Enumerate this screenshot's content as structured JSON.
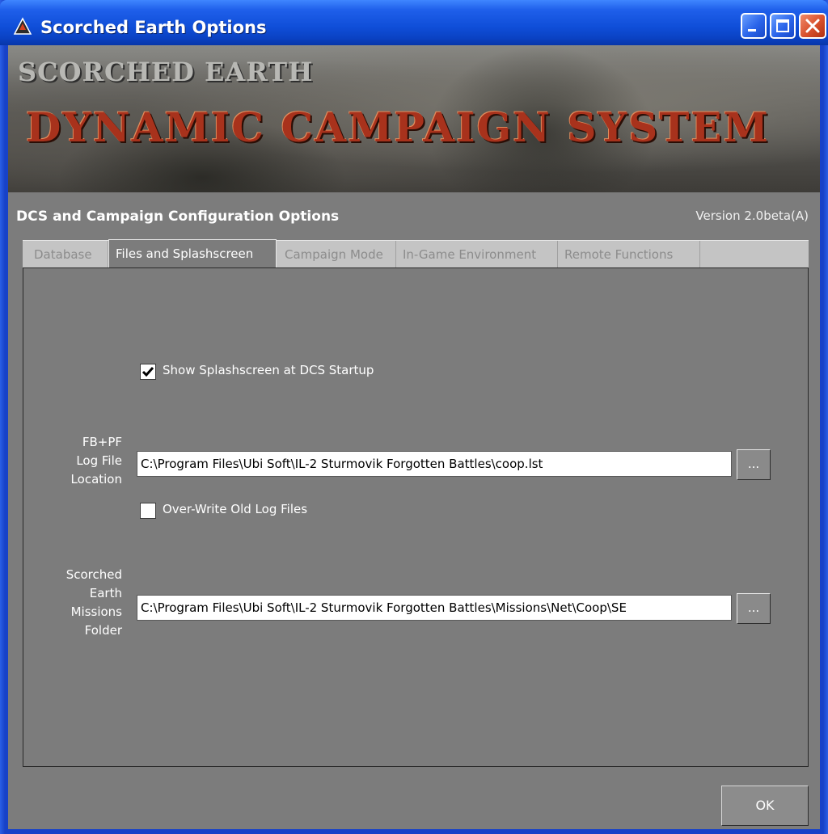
{
  "window": {
    "title": "Scorched Earth Options",
    "icon": "scorched-earth-app-icon",
    "controls": [
      "minimize-icon",
      "maximize-icon",
      "close-icon"
    ]
  },
  "banner": {
    "subtitle": "SCORCHED EARTH",
    "title": "DYNAMIC CAMPAIGN SYSTEM"
  },
  "header": {
    "section_title": "DCS and Campaign Configuration Options",
    "version": "Version 2.0beta(A)"
  },
  "tabs": [
    {
      "label": "Database",
      "active": false
    },
    {
      "label": "Files and Splashscreen",
      "active": true
    },
    {
      "label": "Campaign Mode",
      "active": false
    },
    {
      "label": "In-Game Environment",
      "active": false
    },
    {
      "label": "Remote Functions",
      "active": false
    }
  ],
  "form": {
    "splash_checkbox": {
      "label": "Show Splashscreen at DCS Startup",
      "checked": true
    },
    "log_file": {
      "label_lines": [
        "FB+PF",
        "Log File",
        "Location"
      ],
      "value": "C:\\Program Files\\Ubi Soft\\IL-2 Sturmovik Forgotten Battles\\coop.lst",
      "browse_label": "..."
    },
    "overwrite_checkbox": {
      "label": "Over-Write Old Log Files",
      "checked": false
    },
    "missions_folder": {
      "label_lines": [
        "Scorched",
        "Earth",
        "Missions",
        "Folder"
      ],
      "value": "C:\\Program Files\\Ubi Soft\\IL-2 Sturmovik Forgotten Battles\\Missions\\Net\\Coop\\SE",
      "browse_label": "..."
    }
  },
  "footer": {
    "ok_label": "OK"
  },
  "colors": {
    "titlebar": "#0f4ed8",
    "client_bg": "#7c7c7c",
    "banner_title": "#a8321c",
    "tab_strip": "#c4c4c4"
  }
}
